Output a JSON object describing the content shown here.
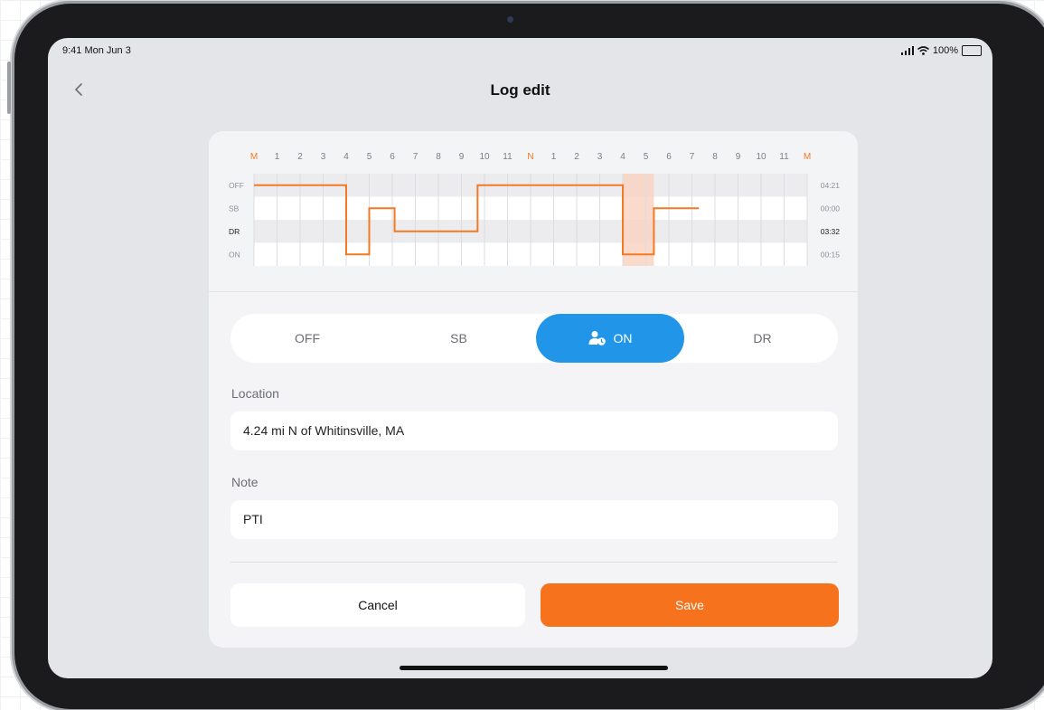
{
  "status_bar": {
    "time": "9:41 Mon Jun 3",
    "battery": "100%"
  },
  "header": {
    "title": "Log edit"
  },
  "log_chart": {
    "hours": [
      "M",
      "1",
      "2",
      "3",
      "4",
      "5",
      "6",
      "7",
      "8",
      "9",
      "10",
      "11",
      "N",
      "1",
      "2",
      "3",
      "4",
      "5",
      "6",
      "7",
      "8",
      "9",
      "10",
      "11",
      "M"
    ],
    "rows": [
      "OFF",
      "SB",
      "DR",
      "ON"
    ],
    "totals": [
      "04:21",
      "00:00",
      "03:32",
      "00:15"
    ],
    "segments": [
      {
        "from": 0,
        "to": 4,
        "status": "OFF"
      },
      {
        "from": 4,
        "to": 5,
        "status": "ON"
      },
      {
        "from": 5,
        "to": 6.1,
        "status": "SB"
      },
      {
        "from": 6.1,
        "to": 9.7,
        "status": "DR"
      },
      {
        "from": 9.7,
        "to": 16,
        "status": "OFF"
      },
      {
        "from": 16,
        "to": 17.35,
        "status": "ON"
      },
      {
        "from": 17.35,
        "to": 19.3,
        "status": "SB"
      }
    ],
    "highlight": {
      "from": 16,
      "to": 17.35
    },
    "colors": {
      "line": "#f27a24",
      "highlight": "#f9d3c2",
      "mark": "#f27a24"
    }
  },
  "status_selector": {
    "options": [
      "OFF",
      "SB",
      "ON",
      "DR"
    ],
    "selected": "ON",
    "active_color": "#2196e8"
  },
  "location": {
    "label": "Location",
    "value": "4.24 mi N of Whitinsville, MA"
  },
  "note": {
    "label": "Note",
    "value": "PTI"
  },
  "actions": {
    "cancel_label": "Cancel",
    "save_label": "Save",
    "save_color": "#f7721d"
  }
}
